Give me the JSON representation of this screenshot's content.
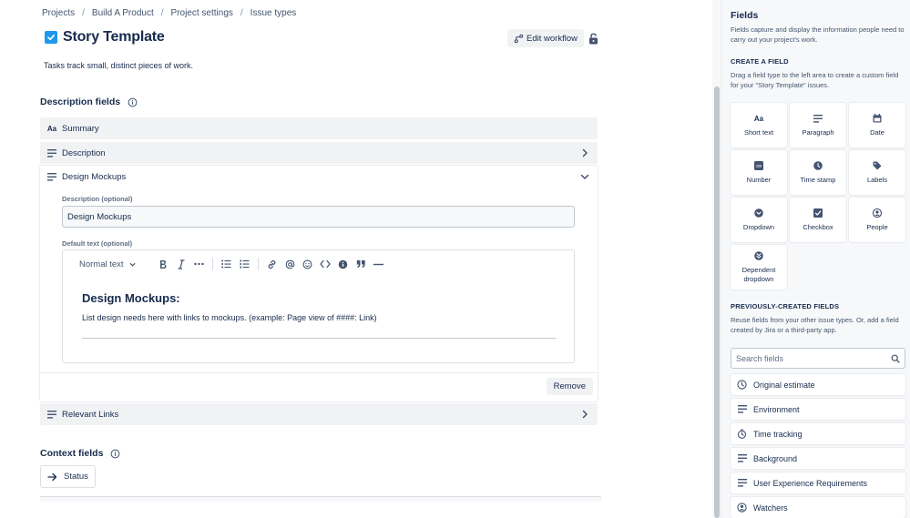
{
  "breadcrumb": [
    "Projects",
    "Build A Product",
    "Project settings",
    "Issue types"
  ],
  "header": {
    "title": "Story Template",
    "edit_workflow": "Edit workflow",
    "description": "Tasks track small, distinct pieces of work."
  },
  "description_fields": {
    "heading": "Description fields",
    "summary": "Summary",
    "description": "Description",
    "design_mockups": {
      "label": "Design Mockups",
      "description_label": "Description (optional)",
      "description_value": "Design Mockups",
      "default_text_label": "Default text (optional)",
      "text_style": "Normal text",
      "editor_heading": "Design Mockups:",
      "editor_paragraph": "List design needs here with links to mockups. (example: Page view of ####: Link)",
      "remove": "Remove"
    },
    "relevant_links": "Relevant Links"
  },
  "context_fields": {
    "heading": "Context fields",
    "status": "Status"
  },
  "panel": {
    "title": "Fields",
    "description": "Fields capture and display the information people need to carry out your project's work.",
    "create_heading": "CREATE A FIELD",
    "create_description": "Drag a field type to the left area to create a custom field for your \"Story Template\" issues.",
    "field_types": [
      "Short text",
      "Paragraph",
      "Date",
      "Number",
      "Time stamp",
      "Labels",
      "Dropdown",
      "Checkbox",
      "People",
      "Dependent dropdown"
    ],
    "previous_heading": "PREVIOUSLY-CREATED FIELDS",
    "previous_description": "Reuse fields from your other issue types. Or, add a field created by Jira or a third-party app.",
    "search_placeholder": "Search fields",
    "previous_fields": [
      "Original estimate",
      "Environment",
      "Time tracking",
      "Background",
      "User Experience Requirements",
      "Watchers"
    ]
  },
  "colors": {
    "accent": "#1d9aef",
    "row_bg": "#f1f2f4",
    "panel_bg": "#f7f8f9"
  }
}
